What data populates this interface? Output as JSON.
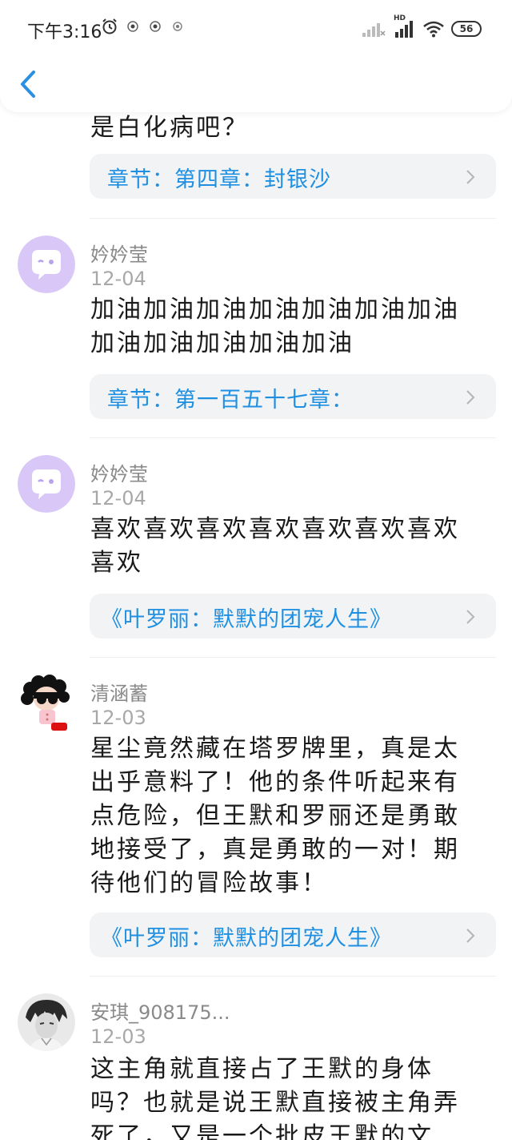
{
  "status_bar": {
    "time": "下午3:16",
    "network_label": "HD",
    "battery": "56"
  },
  "header": {
    "back_icon": "chevron-left-icon"
  },
  "top_partial_comment": {
    "text": "是白化病吧？",
    "chapter": "章节：第四章：封银沙"
  },
  "comments": [
    {
      "username": "妗妗莹",
      "date": "12-04",
      "lines": [
        "加油加油加油加油加油加油加油",
        "加油加油加油加油加油"
      ],
      "chapter": "章节：第一百五十七章：",
      "avatar": "default-chat-bubble-avatar"
    },
    {
      "username": "妗妗莹",
      "date": "12-04",
      "lines": [
        "喜欢喜欢喜欢喜欢喜欢喜欢喜欢",
        "喜欢"
      ],
      "chapter": "《叶罗丽：默默的团宠人生》",
      "avatar": "default-chat-bubble-avatar"
    },
    {
      "username": "清涵蓄",
      "date": "12-03",
      "lines": [
        "星尘竟然藏在塔罗牌里，真是太",
        "出乎意料了！他的条件听起来有",
        "点危险，但王默和罗丽还是勇敢",
        "地接受了，真是勇敢的一对！期",
        "待他们的冒险故事！"
      ],
      "chapter": "《叶罗丽：默默的团宠人生》",
      "avatar": "cartoon-girl-avatar"
    },
    {
      "username": "安琪_908175...",
      "date": "12-03",
      "lines": [
        "这主角就直接占了王默的身体",
        "吗？也就是说王默直接被主角弄",
        "死了，又是一个批皮王默的文"
      ],
      "avatar": "anime-boy-avatar"
    }
  ],
  "colors": {
    "link_blue": "#1e8fe1",
    "pill_bg": "#f2f3f5",
    "avatar_purple": "#d9c8f7",
    "back_blue": "#2b8fe3"
  }
}
